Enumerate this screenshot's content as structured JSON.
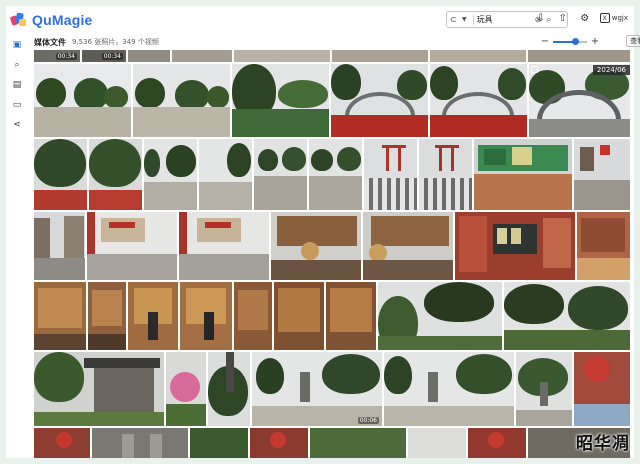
{
  "app": {
    "name": "QuMagie",
    "brand_color": "#2f6fd6"
  },
  "topbar": {
    "search_value": "玩具",
    "user_name": "wgjx",
    "user_initial": "X"
  },
  "sidebar": {
    "items": [
      {
        "icon": "photo-library-icon",
        "glyph": "▣"
      },
      {
        "icon": "search-icon",
        "glyph": "⌕"
      },
      {
        "icon": "album-icon",
        "glyph": "▤"
      },
      {
        "icon": "folder-icon",
        "glyph": "▭"
      },
      {
        "icon": "share-icon",
        "glyph": "⋖"
      }
    ]
  },
  "subheader": {
    "title": "媒体文件",
    "count": "9,536 张照片，349 个视频",
    "view_select": "查看"
  },
  "zoom": {
    "level": 0.65
  },
  "grid": {
    "video_durations": [
      "00:34",
      "00:34",
      "00:06"
    ],
    "date_badge": "2024/06"
  },
  "watermark": "昭华凋"
}
